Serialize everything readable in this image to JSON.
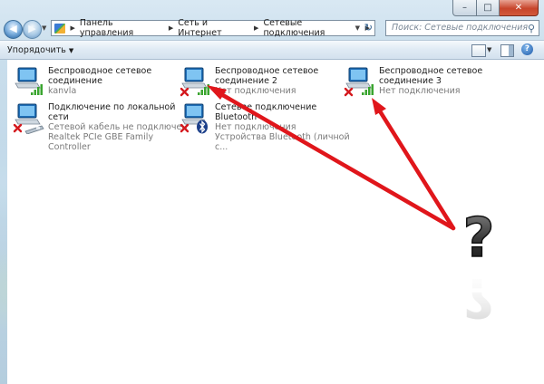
{
  "window": {
    "caption_buttons": {
      "minimize": "–",
      "maximize": "□",
      "close": "✕"
    }
  },
  "address": {
    "crumbs": [
      "Панель управления",
      "Сеть и Интернет",
      "Сетевые подключения"
    ],
    "search_placeholder": "Поиск: Сетевые подключения"
  },
  "toolbar": {
    "organize_label": "Упорядочить"
  },
  "connections": [
    {
      "name": "Беспроводное сетевое\nсоединение",
      "status": "kanvla",
      "device": "",
      "type": "wireless",
      "disconnected": false
    },
    {
      "name": "Беспроводное сетевое\nсоединение 2",
      "status": "Нет подключения",
      "device": "",
      "type": "wireless",
      "disconnected": true
    },
    {
      "name": "Беспроводное сетевое\nсоединение 3",
      "status": "Нет подключения",
      "device": "",
      "type": "wireless",
      "disconnected": true
    },
    {
      "name": "Подключение по локальной сети",
      "status": "Сетевой кабель не подключен",
      "device": "Realtek PCIe GBE Family Controller",
      "type": "lan",
      "disconnected": true
    },
    {
      "name": "Сетевое подключение Bluetooth",
      "status": "Нет подключения",
      "device": "Устройства Bluetooth (личной с...",
      "type": "bluetooth",
      "disconnected": true
    }
  ],
  "annotation": {
    "question_mark": "?",
    "arrow_color": "#e0161b"
  },
  "colors": {
    "signal_green": "#3aa52f",
    "error_red": "#d4191e"
  }
}
